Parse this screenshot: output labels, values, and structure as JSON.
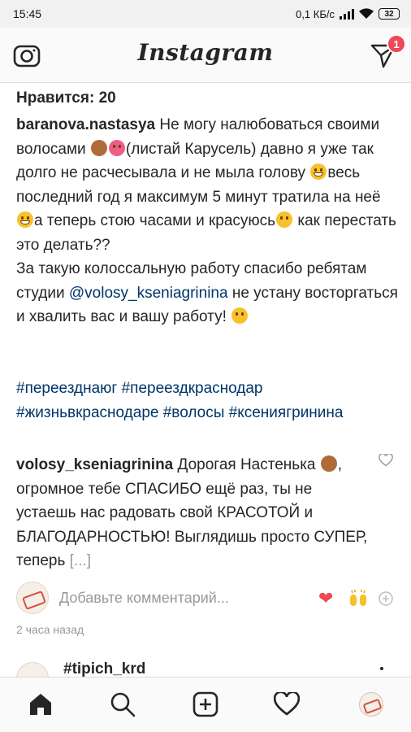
{
  "status": {
    "time": "15:45",
    "speed": "0,1 КБ/с",
    "battery": "32"
  },
  "header": {
    "logo_text": "Instagram",
    "dm_badge": "1"
  },
  "post": {
    "likes": "Нравится: 20",
    "caption_user": "baranova.nastasya",
    "caption_part1": " Не могу налюбоваться своими волосами ",
    "caption_part2": "(листай Карусель) давно я уже так долго не расчесывала и не мыла голову ",
    "caption_part3": "весь последний год я максимум 5 минут тратила на неё ",
    "caption_part4": "а теперь стою часами и красуюсь",
    "caption_part5": " как перестать это делать??",
    "caption_part6": "За такую колоссальную работу спасибо ребятам студии ",
    "mention": "@volosy_kseniagrinina",
    "caption_part7": "  не устану восторгаться и хвалить вас и вашу работу! ",
    "hashtags": "#переезднаюг #переездкраснодар #жизньвкраснодаре #волосы #ксениягринина"
  },
  "comment": {
    "user": "volosy_kseniagrinina",
    "text": " Дорогая Настенька ",
    "text2": ", огромное тебе СПАСИБО ещё раз, ты не устаешь нас радовать свой КРАСОТОЙ и БЛАГОДАРНОСТЬЮ! Выглядишь просто СУПЕР, теперь ",
    "more": "[...]"
  },
  "add_comment": {
    "placeholder": "Добавьте комментарий..."
  },
  "timestamp": "2 часа назад",
  "next_post": {
    "user": "#tipich_krd"
  },
  "colors": {
    "link": "#003569",
    "badge": "#ed4956",
    "muted": "#999999"
  },
  "icons": {
    "camera": "camera-icon",
    "direct": "direct-message-icon",
    "home": "home-icon",
    "search": "search-icon",
    "add": "add-post-icon",
    "activity": "heart-icon",
    "profile": "profile-avatar"
  }
}
